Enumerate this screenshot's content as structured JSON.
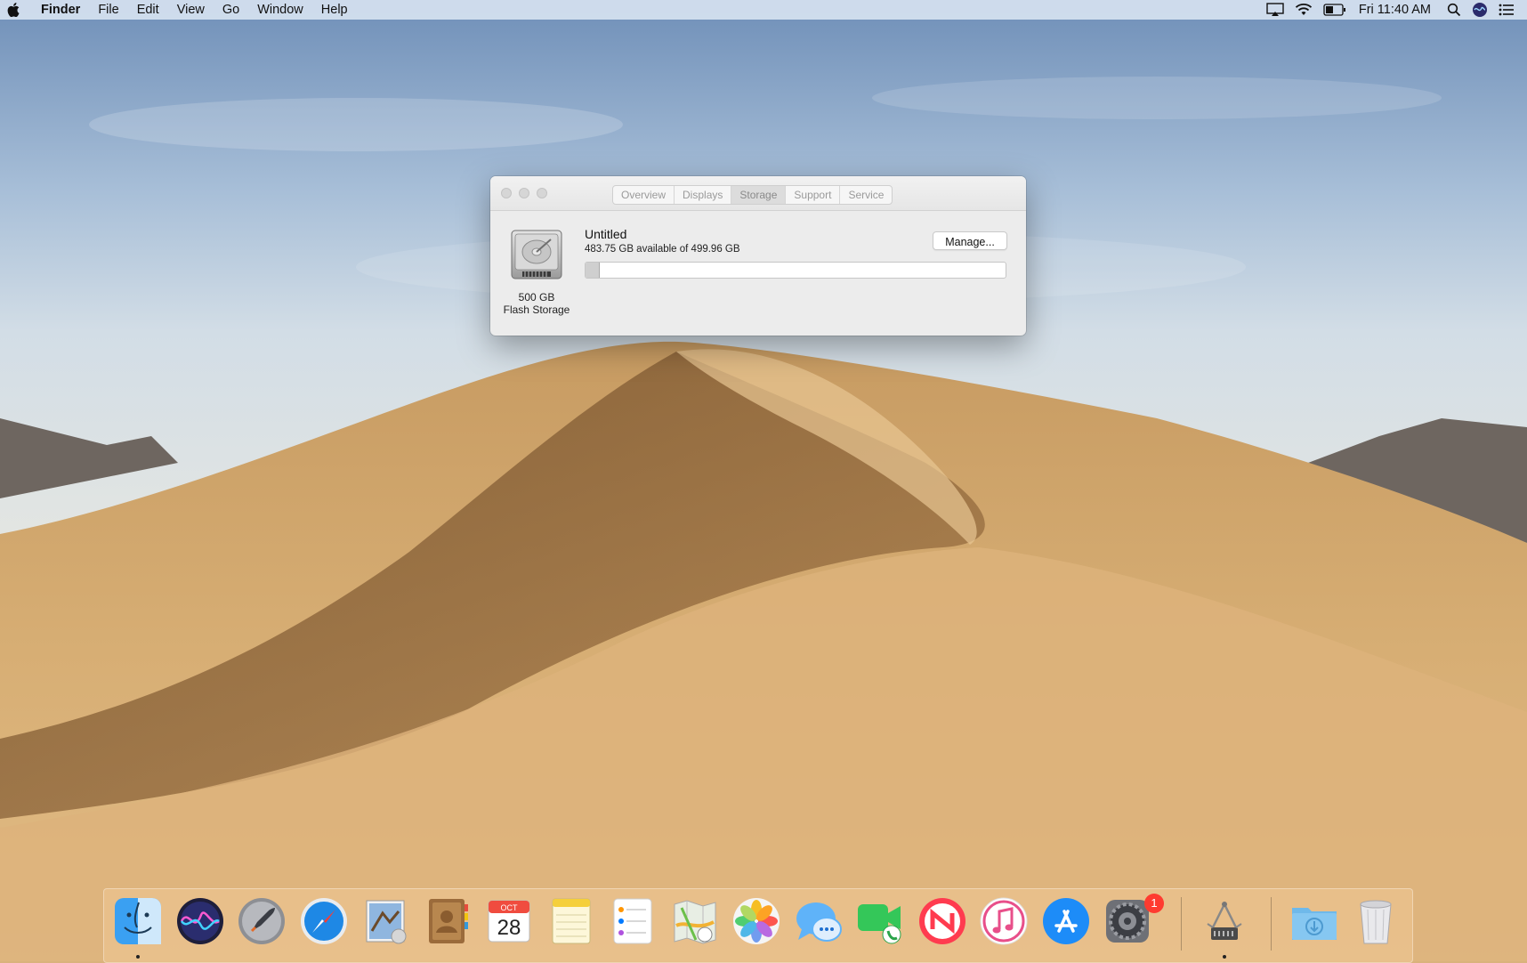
{
  "menubar": {
    "app_name": "Finder",
    "menus": [
      "File",
      "Edit",
      "View",
      "Go",
      "Window",
      "Help"
    ],
    "clock": "Fri 11:40 AM",
    "status_icons": [
      "airplay-icon",
      "wifi-icon",
      "battery-icon",
      "spotlight-icon",
      "siri-icon",
      "notification-center-icon"
    ]
  },
  "window": {
    "tabs": [
      "Overview",
      "Displays",
      "Storage",
      "Support",
      "Service"
    ],
    "active_tab": "Storage",
    "drive": {
      "size": "500 GB",
      "type": "Flash Storage"
    },
    "volume": {
      "name": "Untitled",
      "availability": "483.75 GB available of 499.96 GB",
      "used_fraction": 0.0324
    },
    "manage_button": "Manage..."
  },
  "dock": {
    "calendar": {
      "month": "OCT",
      "day": "28"
    },
    "system_prefs_badge": "1",
    "apps": [
      "Finder",
      "Siri",
      "Launchpad",
      "Safari",
      "Mail",
      "Contacts",
      "Calendar",
      "Notes",
      "Reminders",
      "Maps",
      "Photos",
      "Messages",
      "FaceTime",
      "News",
      "iTunes",
      "App Store",
      "System Preferences",
      "System Information",
      "Downloads",
      "Trash"
    ]
  }
}
